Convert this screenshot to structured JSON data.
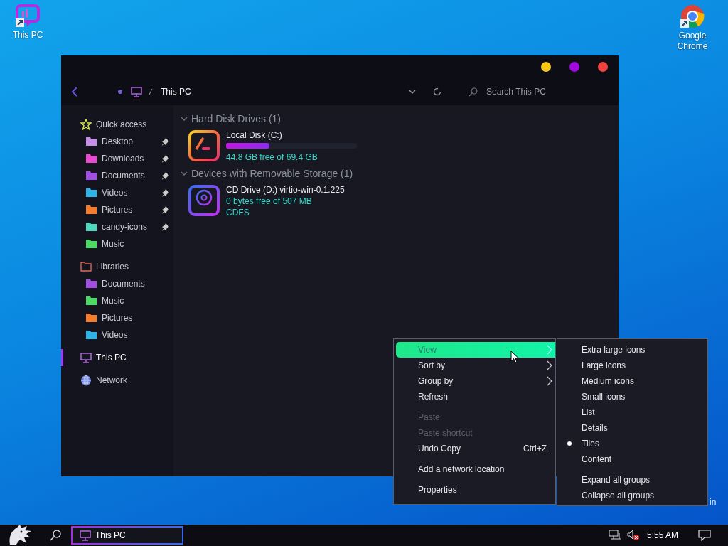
{
  "desktop_icons": [
    {
      "label": "This PC",
      "kind": "pc"
    },
    {
      "label": "Google Chrome",
      "kind": "chrome"
    }
  ],
  "window": {
    "controls": [
      {
        "color": "#f5c518"
      },
      {
        "color": "#a20be0"
      },
      {
        "color": "#f0423f"
      }
    ],
    "address": {
      "path": "This PC",
      "search_placeholder": "Search This PC"
    },
    "sidebar": [
      {
        "label": "Quick access",
        "kind": "star",
        "selected": false,
        "children": [
          {
            "label": "Desktop",
            "color": "#c58ee8",
            "pinned": true,
            "selected": false
          },
          {
            "label": "Downloads",
            "color": "#e84ad0",
            "pinned": true,
            "selected": false
          },
          {
            "label": "Documents",
            "color": "#a04fe0",
            "pinned": true,
            "selected": false
          },
          {
            "label": "Videos",
            "color": "#2fb4e8",
            "pinned": true,
            "selected": false
          },
          {
            "label": "Pictures",
            "color": "#f57c2a",
            "pinned": true,
            "selected": false
          },
          {
            "label": "candy-icons",
            "color": "#4fd8c0",
            "pinned": true,
            "selected": false
          },
          {
            "label": "Music",
            "color": "#4cd964",
            "pinned": false,
            "selected": false
          }
        ]
      },
      {
        "label": "Libraries",
        "kind": "library",
        "selected": false,
        "children": [
          {
            "label": "Documents",
            "color": "#a04fe0",
            "pinned": false,
            "selected": false
          },
          {
            "label": "Music",
            "color": "#4cd964",
            "pinned": false,
            "selected": false
          },
          {
            "label": "Pictures",
            "color": "#f57c2a",
            "pinned": false,
            "selected": false
          },
          {
            "label": "Videos",
            "color": "#2fb4e8",
            "pinned": false,
            "selected": false
          }
        ]
      },
      {
        "label": "This PC",
        "kind": "pc",
        "selected": true
      },
      {
        "label": "Network",
        "kind": "network",
        "selected": false
      }
    ],
    "groups": [
      {
        "title": "Hard Disk Drives (1)",
        "expanded": true,
        "drives": [
          {
            "kind": "disk",
            "name": "Local Disk (C:)",
            "level": 0.33,
            "free": "44.8 GB free of 69.4 GB"
          }
        ]
      },
      {
        "title": "Devices with Removable Storage (1)",
        "expanded": true,
        "drives": [
          {
            "kind": "cd",
            "name": "CD Drive (D:) virtio-win-0.1.225",
            "free": "0 bytes free of 507 MB",
            "filesystem": "CDFS"
          }
        ]
      }
    ]
  },
  "context_menu": [
    [
      {
        "label": "View",
        "submenu": true,
        "selected": true,
        "disabled": false
      },
      {
        "label": "Sort by",
        "submenu": true,
        "selected": false,
        "disabled": false
      },
      {
        "label": "Group by",
        "submenu": true,
        "selected": false,
        "disabled": false
      },
      {
        "label": "Refresh",
        "submenu": false,
        "selected": false,
        "disabled": false
      }
    ],
    [
      {
        "label": "Paste",
        "submenu": false,
        "selected": false,
        "disabled": true
      },
      {
        "label": "Paste shortcut",
        "submenu": false,
        "selected": false,
        "disabled": true
      },
      {
        "label": "Undo Copy",
        "shortcut": "Ctrl+Z",
        "submenu": false,
        "selected": false,
        "disabled": false
      }
    ],
    [
      {
        "label": "Add a network location",
        "submenu": false,
        "selected": false,
        "disabled": false
      }
    ],
    [
      {
        "label": "Properties",
        "submenu": false,
        "selected": false,
        "disabled": false
      }
    ]
  ],
  "view_submenu": [
    [
      {
        "label": "Extra large icons",
        "selected": false
      },
      {
        "label": "Large icons",
        "selected": false
      },
      {
        "label": "Medium icons",
        "selected": false
      },
      {
        "label": "Small icons",
        "selected": false
      },
      {
        "label": "List",
        "selected": false
      },
      {
        "label": "Details",
        "selected": false
      },
      {
        "label": "Tiles",
        "selected": true
      },
      {
        "label": "Content",
        "selected": false
      }
    ],
    [
      {
        "label": "Expand all groups",
        "selected": false
      },
      {
        "label": "Collapse all groups",
        "selected": false
      }
    ]
  ],
  "desktop_text": "in",
  "taskbar": {
    "active_app": "This PC",
    "clock": "5:55 AM"
  }
}
